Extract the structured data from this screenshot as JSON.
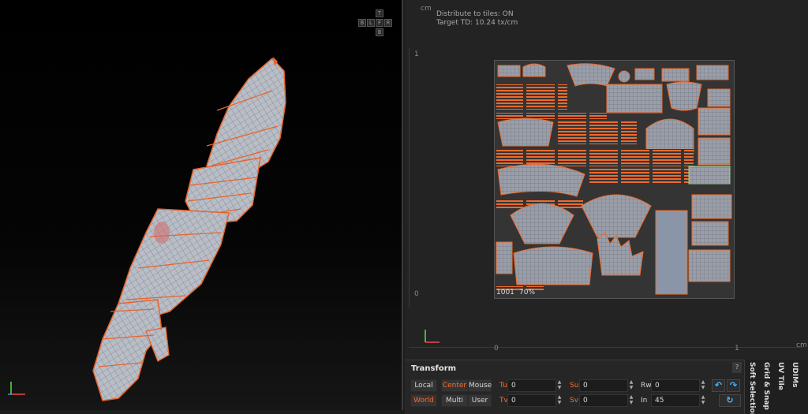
{
  "viewport3d": {
    "navcube": {
      "top": "T",
      "bottom": "B",
      "row": [
        "B",
        "L",
        "F",
        "R"
      ]
    }
  },
  "uv_view": {
    "unit_top": "cm",
    "unit_right": "cm",
    "info_line1": "Distribute to tiles: ON",
    "info_line2": "Target TD: 10.24 tx/cm",
    "ruler_v_top": "1",
    "ruler_v_bottom": "0",
    "ruler_h_left": "0",
    "ruler_h_right": "1",
    "tile_id": "1001",
    "tile_fill": "70%"
  },
  "transform": {
    "title": "Transform",
    "help_label": "?",
    "local": "Local",
    "world": "World",
    "center": "Center",
    "multi": "Multi",
    "mouse": "Mouse",
    "user": "User",
    "tu_label": "Tu",
    "tu_value": "0",
    "tv_label": "Tv",
    "tv_value": "0",
    "su_label": "Su",
    "su_value": "0",
    "sv_label": "Sv",
    "sv_value": "0",
    "rw_label": "Rw",
    "rw_value": "0",
    "in_label": "In",
    "in_value": "45"
  },
  "side_tabs": [
    "UDIMs",
    "UV Tile",
    "Grid & Snap",
    "Soft Selection"
  ],
  "colors": {
    "accent": "#ff6a2b",
    "blue": "#4ab6ff",
    "panel": "#262626",
    "uv_island": "#9a9ea8",
    "uv_edge": "#f06a2c"
  }
}
